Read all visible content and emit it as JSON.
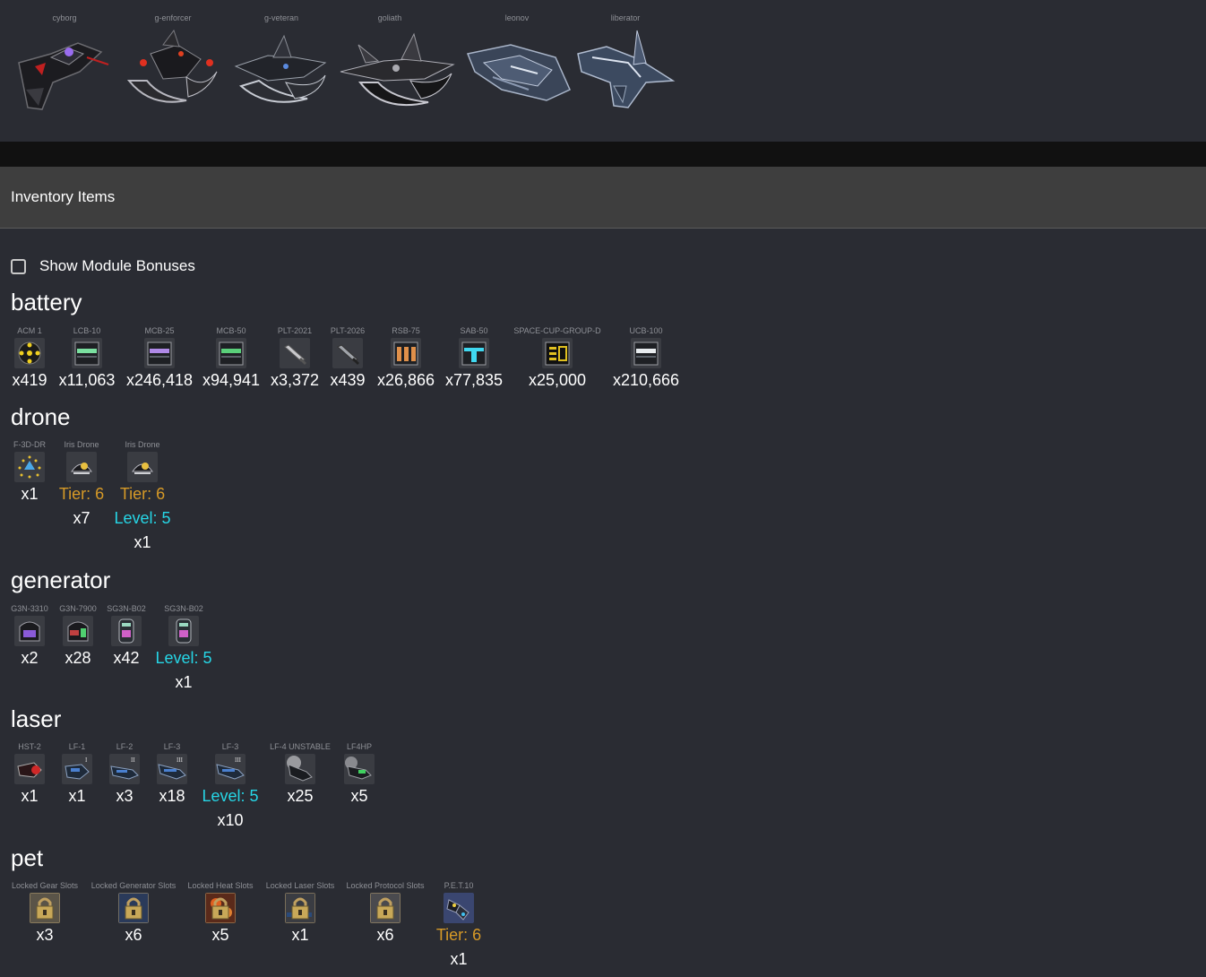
{
  "ships": [
    {
      "name": "cyborg",
      "icon": "cyborg-ship-icon"
    },
    {
      "name": "g-enforcer",
      "icon": "g-enforcer-ship-icon"
    },
    {
      "name": "g-veteran",
      "icon": "g-veteran-ship-icon"
    },
    {
      "name": "goliath",
      "icon": "goliath-ship-icon"
    },
    {
      "name": "leonov",
      "icon": "leonov-ship-icon"
    },
    {
      "name": "liberator",
      "icon": "liberator-ship-icon"
    }
  ],
  "inventory": {
    "title": "Inventory Items",
    "toggle_label": "Show Module Bonuses",
    "toggle_checked": false
  },
  "categories": {
    "battery": {
      "title": "battery",
      "items": [
        {
          "name": "ACM 1",
          "qty": "x419",
          "icon": "mine-icon"
        },
        {
          "name": "LCB-10",
          "qty": "x11,063",
          "icon": "ammo-box-green-icon"
        },
        {
          "name": "MCB-25",
          "qty": "x246,418",
          "icon": "ammo-box-purple-icon"
        },
        {
          "name": "MCB-50",
          "qty": "x94,941",
          "icon": "ammo-box-green-icon"
        },
        {
          "name": "PLT-2021",
          "qty": "x3,372",
          "icon": "rocket-icon"
        },
        {
          "name": "PLT-2026",
          "qty": "x439",
          "icon": "rocket-icon"
        },
        {
          "name": "RSB-75",
          "qty": "x26,866",
          "icon": "ammo-box-orange-icon"
        },
        {
          "name": "SAB-50",
          "qty": "x77,835",
          "icon": "ammo-box-cyan-icon"
        },
        {
          "name": "SPACE-CUP-GROUP-D",
          "qty": "x25,000",
          "icon": "ammo-box-gold-icon"
        },
        {
          "name": "UCB-100",
          "qty": "x210,666",
          "icon": "ammo-box-white-icon"
        }
      ]
    },
    "drone": {
      "title": "drone",
      "items": [
        {
          "name": "F-3D-DR",
          "tier": "",
          "level": "",
          "qty": "x1",
          "icon": "drone-formation-icon"
        },
        {
          "name": "Iris Drone",
          "tier": "Tier: 6",
          "level": "",
          "qty": "x7",
          "icon": "iris-drone-icon"
        },
        {
          "name": "Iris Drone",
          "tier": "Tier: 6",
          "level": "Level: 5",
          "qty": "x1",
          "icon": "iris-drone-icon"
        }
      ]
    },
    "generator": {
      "title": "generator",
      "items": [
        {
          "name": "G3N-3310",
          "level": "",
          "qty": "x2",
          "icon": "generator-purple-icon"
        },
        {
          "name": "G3N-7900",
          "level": "",
          "qty": "x28",
          "icon": "generator-green-icon"
        },
        {
          "name": "SG3N-B02",
          "level": "",
          "qty": "x42",
          "icon": "shield-generator-icon"
        },
        {
          "name": "SG3N-B02",
          "level": "Level: 5",
          "qty": "x1",
          "icon": "shield-generator-icon"
        }
      ]
    },
    "laser": {
      "title": "laser",
      "items": [
        {
          "name": "HST-2",
          "level": "",
          "qty": "x1",
          "icon": "launcher-red-icon"
        },
        {
          "name": "LF-1",
          "level": "",
          "qty": "x1",
          "icon": "laser-cannon-icon"
        },
        {
          "name": "LF-2",
          "level": "",
          "qty": "x3",
          "icon": "laser-cannon-icon"
        },
        {
          "name": "LF-3",
          "level": "",
          "qty": "x18",
          "icon": "laser-cannon-icon"
        },
        {
          "name": "LF-3",
          "level": "Level: 5",
          "qty": "x10",
          "icon": "laser-cannon-icon"
        },
        {
          "name": "LF-4 UNSTABLE",
          "level": "",
          "qty": "x25",
          "icon": "laser-cannon-white-icon"
        },
        {
          "name": "LF4HP",
          "level": "",
          "qty": "x5",
          "icon": "laser-cannon-green-icon"
        }
      ]
    },
    "pet": {
      "title": "pet",
      "items": [
        {
          "name": "Locked Gear Slots",
          "tier": "",
          "qty": "x3",
          "icon": "lock-gear-icon"
        },
        {
          "name": "Locked Generator Slots",
          "tier": "",
          "qty": "x6",
          "icon": "lock-generator-icon"
        },
        {
          "name": "Locked Heat Slots",
          "tier": "",
          "qty": "x5",
          "icon": "lock-heat-icon"
        },
        {
          "name": "Locked Laser Slots",
          "tier": "",
          "qty": "x1",
          "icon": "lock-laser-icon"
        },
        {
          "name": "Locked Protocol Slots",
          "tier": "",
          "qty": "x6",
          "icon": "lock-protocol-icon"
        },
        {
          "name": "P.E.T.10",
          "tier": "Tier: 6",
          "qty": "x1",
          "icon": "pet-robot-icon"
        }
      ]
    }
  },
  "colors": {
    "background": "#2a2c33",
    "header_bar": "#3e3e3e",
    "tier": "#d79a27",
    "level": "#26d6e6",
    "item_name": "#8e9096"
  }
}
